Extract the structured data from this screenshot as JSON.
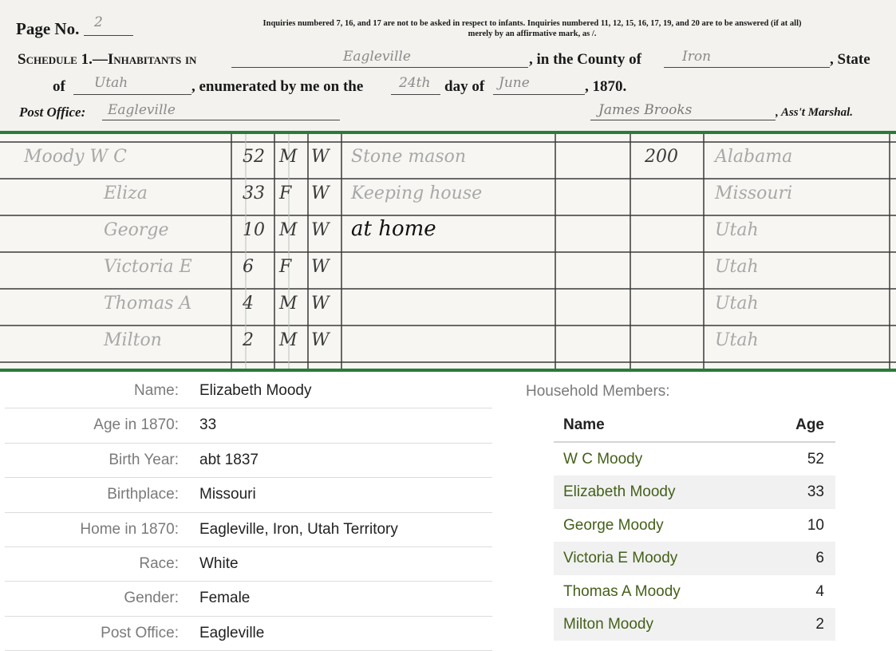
{
  "census_header": {
    "page_label": "Page No.",
    "page_number": "2",
    "notes_line1": "Inquiries numbered 7, 16, and 17 are not to be asked in respect to infants. Inquiries numbered 11, 12, 15, 16, 17, 19, and 20 are to be answered (if at all)",
    "notes_line2": "merely by an affirmative mark, as /.",
    "schedule_label": "Schedule 1.—Inhabitants in",
    "locality": "Eagleville",
    "county_label": ", in the County of",
    "county": "Iron",
    "state_label": ", State",
    "of_label": "of",
    "state": "Utah",
    "enumerated_label": ", enumerated by me on the",
    "day": "24th",
    "day_of_label": "day of",
    "month": "June",
    "year_label": ", 1870.",
    "post_office_label": "Post Office:",
    "post_office": "Eagleville",
    "marshal_name": "James Brooks",
    "marshal_label": ", Ass't Marshal."
  },
  "census_rows": [
    {
      "name": "Moody W C",
      "age": "52",
      "sex": "M",
      "race": "W",
      "occupation": "Stone mason",
      "value": "200",
      "birthplace": "Alabama"
    },
    {
      "name": "Eliza",
      "age": "33",
      "sex": "F",
      "race": "W",
      "occupation": "Keeping house",
      "value": "",
      "birthplace": "Missouri"
    },
    {
      "name": "George",
      "age": "10",
      "sex": "M",
      "race": "W",
      "occupation": "at home",
      "value": "",
      "birthplace": "Utah"
    },
    {
      "name": "Victoria E",
      "age": "6",
      "sex": "F",
      "race": "W",
      "occupation": "",
      "value": "",
      "birthplace": "Utah"
    },
    {
      "name": "Thomas A",
      "age": "4",
      "sex": "M",
      "race": "W",
      "occupation": "",
      "value": "",
      "birthplace": "Utah"
    },
    {
      "name": "Milton",
      "age": "2",
      "sex": "M",
      "race": "W",
      "occupation": "",
      "value": "",
      "birthplace": "Utah"
    }
  ],
  "details": [
    {
      "label": "Name:",
      "value": "Elizabeth Moody"
    },
    {
      "label": "Age in 1870:",
      "value": "33"
    },
    {
      "label": "Birth Year:",
      "value": "abt 1837"
    },
    {
      "label": "Birthplace:",
      "value": "Missouri"
    },
    {
      "label": "Home in 1870:",
      "value": "Eagleville, Iron, Utah Territory"
    },
    {
      "label": "Race:",
      "value": "White"
    },
    {
      "label": "Gender:",
      "value": "Female"
    },
    {
      "label": "Post Office:",
      "value": "Eagleville"
    }
  ],
  "household": {
    "title": "Household Members:",
    "col_name": "Name",
    "col_age": "Age",
    "members": [
      {
        "name": "W C Moody",
        "age": "52"
      },
      {
        "name": "Elizabeth Moody",
        "age": "33"
      },
      {
        "name": "George Moody",
        "age": "10"
      },
      {
        "name": "Victoria E Moody",
        "age": "6"
      },
      {
        "name": "Thomas A Moody",
        "age": "4"
      },
      {
        "name": "Milton Moody",
        "age": "2"
      }
    ]
  },
  "colors": {
    "accent_line": "#2a7a3a",
    "link": "#44601a"
  }
}
